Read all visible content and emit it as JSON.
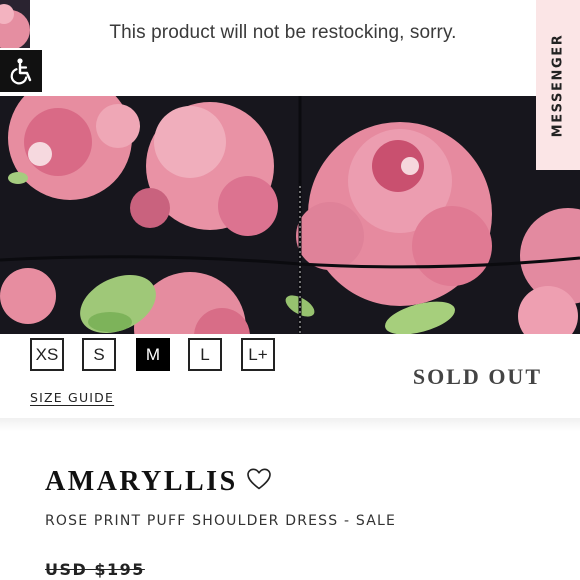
{
  "notice": {
    "text": "This product will not be restocking, sorry."
  },
  "messenger": {
    "label": "MESSENGER"
  },
  "accessibility": {
    "icon": "wheelchair-accessibility-icon"
  },
  "sizes": {
    "options": [
      "XS",
      "S",
      "M",
      "L",
      "L+"
    ],
    "selected": "M",
    "guide_label": "SIZE GUIDE",
    "status": "SOLD OUT"
  },
  "product": {
    "name": "AMARYLLIS",
    "subtitle": "ROSE PRINT PUFF SHOULDER DRESS - SALE",
    "price": "USD $195",
    "wishlist_icon": "heart-outline-icon"
  },
  "colors": {
    "fabric": "#17161d",
    "rose": "#e88fa3",
    "leaf": "#9fc878",
    "messenger_bg": "#fbe5e6",
    "selected_size": "#000000"
  }
}
